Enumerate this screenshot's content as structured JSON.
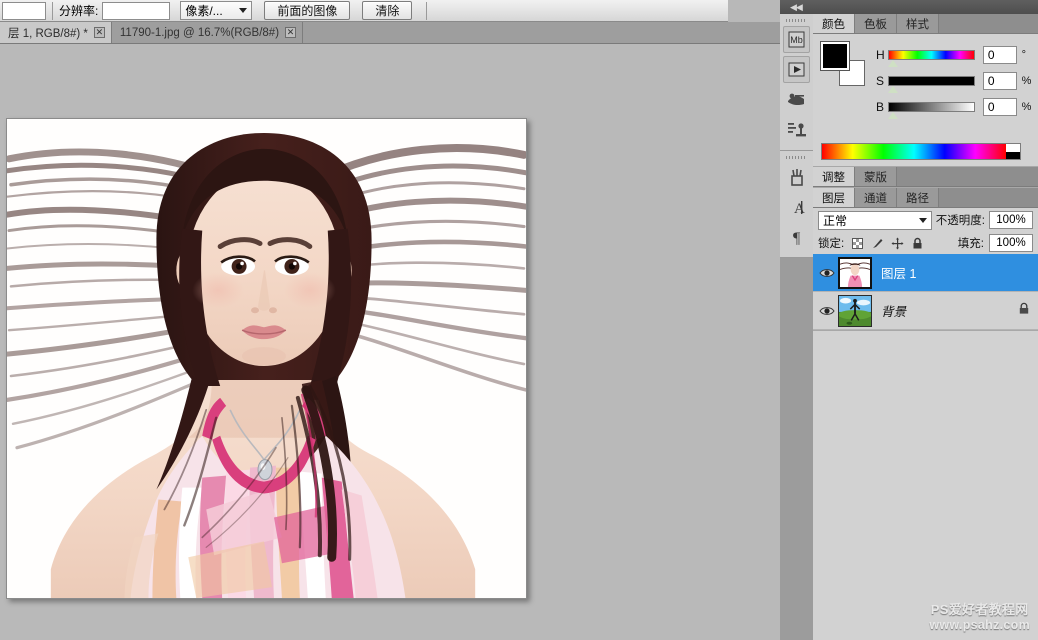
{
  "options_bar": {
    "stub_field_value": "",
    "resolution_label": "分辨率:",
    "resolution_value": "",
    "resolution_placeholder": "",
    "unit_select": "像素/...",
    "front_image_button": "前面的图像",
    "clear_button": "清除"
  },
  "document_tabs": [
    {
      "label": "层 1, RGB/8#) *",
      "close": "✕",
      "active": true
    },
    {
      "label": "11790-1.jpg @ 16.7%(RGB/8#)",
      "close": "✕",
      "active": false
    }
  ],
  "dock": {
    "collapse_arrows": "◀◀",
    "icon_rail": [
      {
        "name": "mini-bridge-icon",
        "glyph": "Mb"
      },
      {
        "name": "mini-player-icon",
        "glyph": "▶"
      },
      {
        "name": "adjustments-icon",
        "glyph": "⌦"
      },
      {
        "name": "histogram-icon",
        "glyph": "⫼"
      },
      {
        "name": "brush-preset-icon",
        "glyph": "⚘"
      },
      {
        "name": "character-icon",
        "glyph": "A"
      },
      {
        "name": "paragraph-icon",
        "glyph": "¶"
      }
    ]
  },
  "color_panel": {
    "tabs": [
      {
        "label": "颜色",
        "active": true
      },
      {
        "label": "色板",
        "active": false
      },
      {
        "label": "样式",
        "active": false
      }
    ],
    "foreground_color": "#000000",
    "background_color": "#ffffff",
    "sliders": [
      {
        "label": "H",
        "value": "0",
        "unit": "°"
      },
      {
        "label": "S",
        "value": "0",
        "unit": "%"
      },
      {
        "label": "B",
        "value": "0",
        "unit": "%"
      }
    ]
  },
  "adjust_panel": {
    "tabs": [
      {
        "label": "调整",
        "active": true
      },
      {
        "label": "蒙版",
        "active": false
      }
    ]
  },
  "layers_panel": {
    "tabs": [
      {
        "label": "图层",
        "active": true
      },
      {
        "label": "通道",
        "active": false
      },
      {
        "label": "路径",
        "active": false
      }
    ],
    "blend_mode": "正常",
    "opacity_label": "不透明度:",
    "opacity_value": "100%",
    "lock_label": "锁定:",
    "fill_label": "填充:",
    "fill_value": "100%",
    "selection_color": "#2f8fe0",
    "layers": [
      {
        "name": "图层 1",
        "visible": true,
        "selected": true,
        "locked": false,
        "italic": false
      },
      {
        "name": "背景",
        "visible": true,
        "selected": false,
        "locked": true,
        "italic": true
      }
    ]
  },
  "watermark": {
    "line1": "PS爱好者教程网",
    "line2": "www.psahz.com"
  }
}
